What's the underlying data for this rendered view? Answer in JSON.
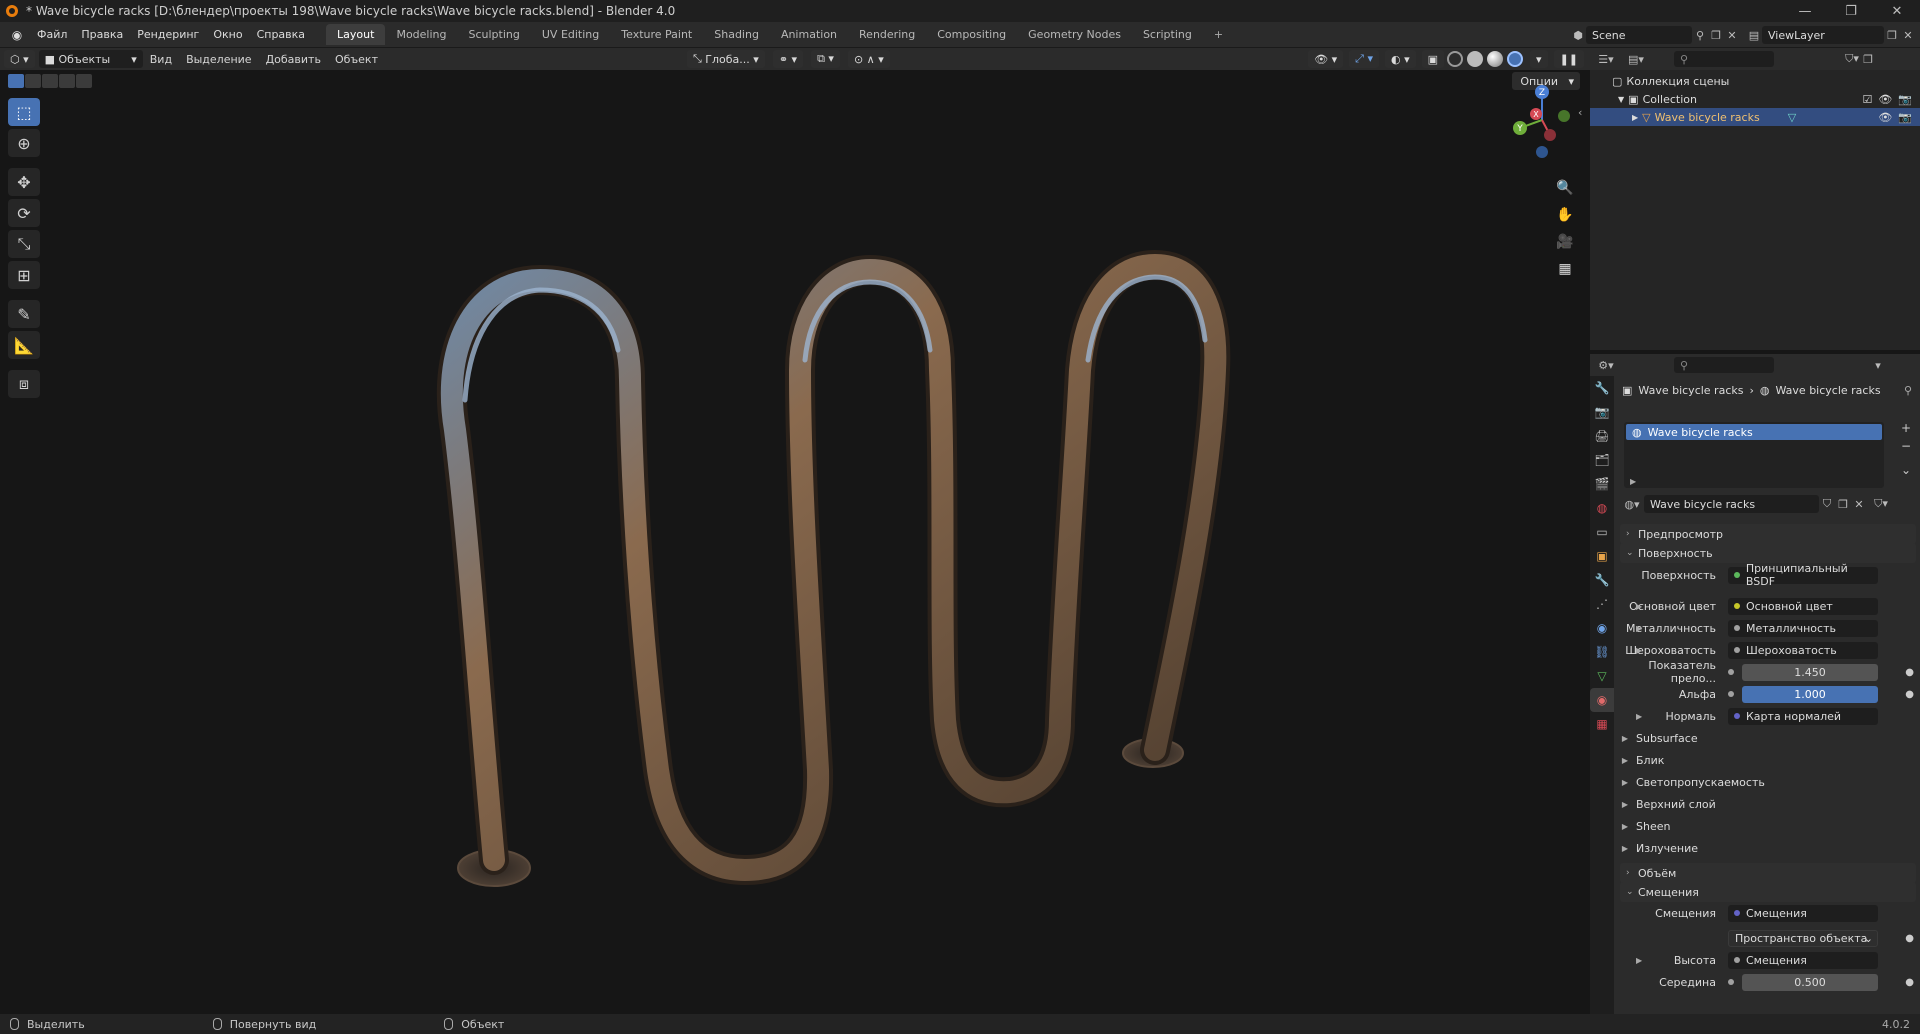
{
  "window": {
    "title": "* Wave bicycle racks [D:\\блендер\\проекты 198\\Wave bicycle racks\\Wave bicycle racks.blend] - Blender 4.0",
    "controls": [
      "—",
      "❐",
      "✕"
    ]
  },
  "menu": [
    "Файл",
    "Правка",
    "Рендеринг",
    "Окно",
    "Справка"
  ],
  "workspaces": {
    "tabs": [
      "Layout",
      "Modeling",
      "Sculpting",
      "UV Editing",
      "Texture Paint",
      "Shading",
      "Animation",
      "Rendering",
      "Compositing",
      "Geometry Nodes",
      "Scripting"
    ],
    "active": "Layout",
    "add": "+"
  },
  "scene": {
    "name": "Scene"
  },
  "view_layer": {
    "name": "ViewLayer"
  },
  "viewport_header": {
    "mode": "Объекты",
    "menus": [
      "Вид",
      "Выделение",
      "Добавить",
      "Объект"
    ],
    "orientation": "Глоба...",
    "options": "Опции"
  },
  "outliner": {
    "root": "Коллекция сцены",
    "collection": "Collection",
    "object": "Wave bicycle racks"
  },
  "properties": {
    "breadcrumb": [
      "Wave bicycle racks",
      "Wave bicycle racks"
    ],
    "slot": "Wave bicycle racks",
    "material_name": "Wave bicycle racks",
    "panels": {
      "preview": "Предпросмотр",
      "surface": "Поверхность",
      "volume": "Объём",
      "displacement": "Смещения"
    },
    "surface_rows": [
      {
        "label": "Поверхность",
        "value": "Принципиальный BSDF",
        "dot": "#5cb85c"
      },
      {
        "label": "Основной цвет",
        "value": "Основной цвет",
        "dot": "#c7c729"
      },
      {
        "label": "Металличность",
        "value": "Металличность",
        "dot": "#a1a1a1"
      },
      {
        "label": "Шероховатость",
        "value": "Шероховатость",
        "dot": "#a1a1a1"
      },
      {
        "label": "Показатель прело...",
        "value": "1.450",
        "dot": "#a1a1a1"
      },
      {
        "label": "Альфа",
        "value": "1.000",
        "dot": "#a1a1a1"
      },
      {
        "label": "Нормаль",
        "value": "Карта нормалей",
        "dot": "#6363c7"
      }
    ],
    "subpanels": [
      "Subsurface",
      "Блик",
      "Светопропускаемость",
      "Верхний слой",
      "Sheen",
      "Излучение"
    ],
    "displacement_rows": [
      {
        "label": "Смещения",
        "value": "Смещения",
        "dot": "#6363c7"
      },
      {
        "label": "",
        "value": "Пространство объекта"
      },
      {
        "label": "Высота",
        "value": "Смещения",
        "dot": "#a1a1a1"
      },
      {
        "label": "Середина",
        "value": "0.500",
        "dot": "#a1a1a1"
      }
    ]
  },
  "statusbar": {
    "items": [
      "Выделить",
      "Повернуть вид",
      "Объект"
    ],
    "version": "4.0.2"
  },
  "colors": {
    "accent": "#4772b3",
    "selection": "#334d80",
    "brand": "#e87d0d"
  }
}
